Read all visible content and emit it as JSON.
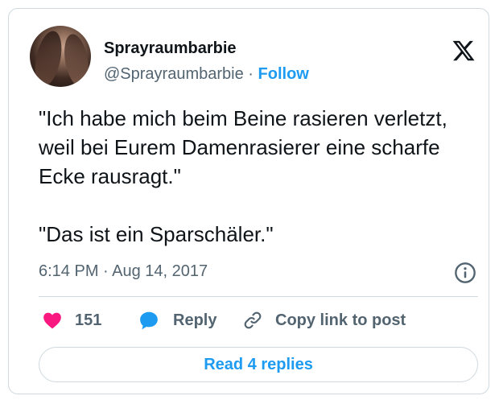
{
  "author": {
    "display_name": "Sprayraumbarbie",
    "handle": "@Sprayraumbarbie",
    "separator": "·",
    "follow_label": "Follow"
  },
  "tweet": {
    "text": "\"Ich habe mich beim Beine rasieren verletzt, weil bei Eurem Damenrasierer eine scharfe Ecke rausragt.\"\n\n\"Das ist ein Sparschäler.\"",
    "timestamp": "6:14 PM · Aug 14, 2017"
  },
  "actions": {
    "like_count": "151",
    "reply_label": "Reply",
    "copy_label": "Copy link to post"
  },
  "read_replies_label": "Read 4 replies",
  "colors": {
    "accent": "#1d9bf0",
    "like": "#f91880",
    "muted": "#536471",
    "border": "#cfd9de"
  },
  "icons": [
    "x-logo-icon",
    "info-icon",
    "heart-icon",
    "speech-bubble-icon",
    "link-icon"
  ]
}
